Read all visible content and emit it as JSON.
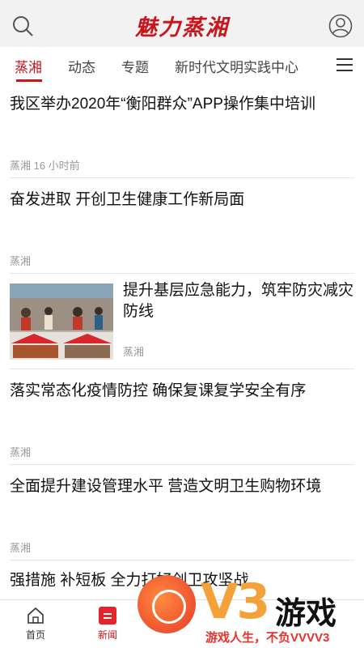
{
  "header": {
    "logo_text": "魅力蒸湘"
  },
  "tabs": [
    {
      "label": "蒸湘"
    },
    {
      "label": "动态"
    },
    {
      "label": "专题"
    },
    {
      "label": "新时代文明实践中心"
    }
  ],
  "news": [
    {
      "title": "我区举办2020年“衡阳群众”APP操作集中培训",
      "source": "蒸湘  16 小时前"
    },
    {
      "title": "奋发进取 开创卫生健康工作新局面",
      "source": "蒸湘"
    },
    {
      "title": "提升基层应急能力，筑牢防灾减灾防线",
      "source": "蒸湘",
      "image": "news-thumbnail-image"
    },
    {
      "title": "落实常态化疫情防控 确保复课复学安全有序",
      "source": "蒸湘"
    },
    {
      "title": "全面提升建设管理水平 营造文明卫生购物环境",
      "source": "蒸湘"
    },
    {
      "title": "强措施 补短板 全力打好创卫攻坚战",
      "source": ""
    }
  ],
  "bottom_nav": [
    {
      "label": "首页",
      "icon": "home-icon"
    },
    {
      "label": "新闻",
      "icon": "news-icon"
    }
  ],
  "watermark": {
    "brand": "V3",
    "name": "游戏",
    "slogan": "游戏人生，不负VVVV3"
  },
  "colors": {
    "accent": "#c8161d",
    "header_bg": "#f2f2f2",
    "divider": "#e5e5e5",
    "meta_text": "#999999"
  }
}
